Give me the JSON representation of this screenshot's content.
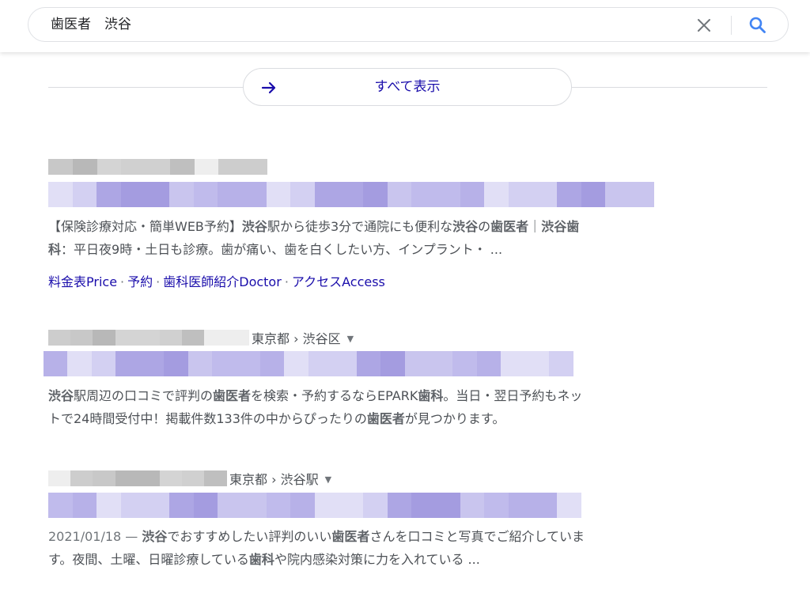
{
  "search": {
    "query": "歯医者　渋谷"
  },
  "show_all": {
    "label": "すべて表示"
  },
  "results": [
    {
      "snippet_parts": [
        {
          "t": "【保険診療対応・簡単WEB予約】",
          "b": false
        },
        {
          "t": "渋谷",
          "b": true
        },
        {
          "t": "駅から徒歩3分で通院にも便利な",
          "b": false
        },
        {
          "t": "渋谷",
          "b": true
        },
        {
          "t": "の",
          "b": false
        },
        {
          "t": "歯医者",
          "b": true
        },
        {
          "t": "｜",
          "b": false
        },
        {
          "t": "渋谷歯",
          "b": true
        },
        {
          "t": "\n",
          "b": false
        },
        {
          "t": "科",
          "b": true
        },
        {
          "t": "：平日夜9時・土日も診療。歯が痛い、歯を白くしたい方、インプラント・ ...",
          "b": false
        }
      ],
      "sitelinks": [
        "料金表Price",
        "予約",
        "歯科医師紹介Doctor",
        "アクセスAccess"
      ]
    },
    {
      "location": "東京都 › 渋谷区",
      "snippet_parts": [
        {
          "t": "渋谷",
          "b": true
        },
        {
          "t": "駅周辺の口コミで評判の",
          "b": false
        },
        {
          "t": "歯医者",
          "b": true
        },
        {
          "t": "を検索・予約するならEPARK",
          "b": false
        },
        {
          "t": "歯科",
          "b": true
        },
        {
          "t": "。当日・翌日予約もネッ",
          "b": false
        },
        {
          "t": "\n",
          "b": false
        },
        {
          "t": "トで24時間受付中！掲載件数133件の中からぴったりの",
          "b": false
        },
        {
          "t": "歯医者",
          "b": true
        },
        {
          "t": "が見つかります。",
          "b": false
        }
      ]
    },
    {
      "location": "東京都 › 渋谷駅",
      "date": "2021/01/18 — ",
      "snippet_parts": [
        {
          "t": "渋谷",
          "b": true
        },
        {
          "t": "でおすすめしたい評判のいい",
          "b": false
        },
        {
          "t": "歯医者",
          "b": true
        },
        {
          "t": "さんを口コミと写真でご紹介していま",
          "b": false
        },
        {
          "t": "\n",
          "b": false
        },
        {
          "t": "す。夜間、土曜、日曜診療している",
          "b": false
        },
        {
          "t": "歯科",
          "b": true
        },
        {
          "t": "や院内感染対策に力を入れている ...",
          "b": false
        }
      ]
    }
  ],
  "colors": {
    "link": "#1a0dab",
    "snippet": "#4d5156",
    "pixel_gray": [
      "#c8c8c8",
      "#d4d4d4",
      "#bfbfbf",
      "#cdcdcd",
      "#b8b8b8",
      "#d0d0d0",
      "#eeeeee"
    ],
    "pixel_purple": [
      "#c9c5ee",
      "#b7b1e8",
      "#d3d0f2",
      "#a49ce0",
      "#c0bbec",
      "#e1dff6",
      "#ada6e4"
    ]
  },
  "icons": {
    "clear": "close-icon",
    "search": "search-icon",
    "arrow": "arrow-right-icon",
    "dropdown": "triangle-down-icon"
  }
}
